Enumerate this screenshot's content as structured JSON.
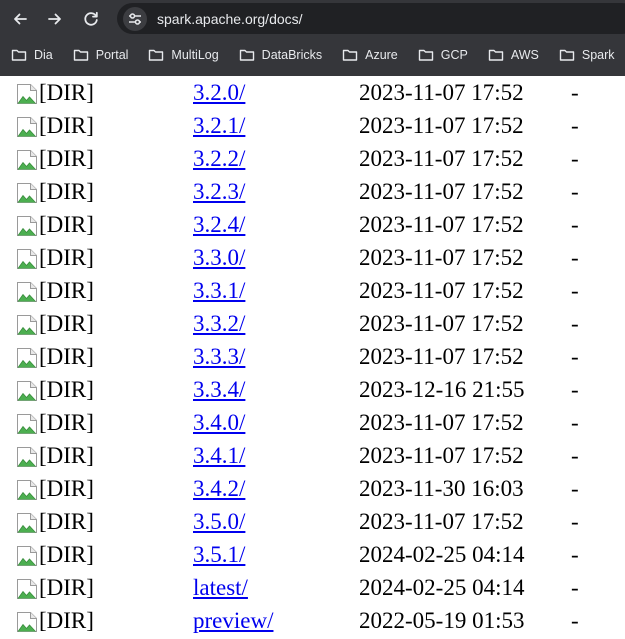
{
  "browser": {
    "url": "spark.apache.org/docs/",
    "bookmarks": [
      "Dia",
      "Portal",
      "MultiLog",
      "DataBricks",
      "Azure",
      "GCP",
      "AWS",
      "Spark"
    ]
  },
  "listing": {
    "rows": [
      {
        "alt": "[DIR]",
        "name": "3.2.0/",
        "modified": "2023-11-07 17:52",
        "size": "-"
      },
      {
        "alt": "[DIR]",
        "name": "3.2.1/",
        "modified": "2023-11-07 17:52",
        "size": "-"
      },
      {
        "alt": "[DIR]",
        "name": "3.2.2/",
        "modified": "2023-11-07 17:52",
        "size": "-"
      },
      {
        "alt": "[DIR]",
        "name": "3.2.3/",
        "modified": "2023-11-07 17:52",
        "size": "-"
      },
      {
        "alt": "[DIR]",
        "name": "3.2.4/",
        "modified": "2023-11-07 17:52",
        "size": "-"
      },
      {
        "alt": "[DIR]",
        "name": "3.3.0/",
        "modified": "2023-11-07 17:52",
        "size": "-"
      },
      {
        "alt": "[DIR]",
        "name": "3.3.1/",
        "modified": "2023-11-07 17:52",
        "size": "-"
      },
      {
        "alt": "[DIR]",
        "name": "3.3.2/",
        "modified": "2023-11-07 17:52",
        "size": "-"
      },
      {
        "alt": "[DIR]",
        "name": "3.3.3/",
        "modified": "2023-11-07 17:52",
        "size": "-"
      },
      {
        "alt": "[DIR]",
        "name": "3.3.4/",
        "modified": "2023-12-16 21:55",
        "size": "-"
      },
      {
        "alt": "[DIR]",
        "name": "3.4.0/",
        "modified": "2023-11-07 17:52",
        "size": "-"
      },
      {
        "alt": "[DIR]",
        "name": "3.4.1/",
        "modified": "2023-11-07 17:52",
        "size": "-"
      },
      {
        "alt": "[DIR]",
        "name": "3.4.2/",
        "modified": "2023-11-30 16:03",
        "size": "-"
      },
      {
        "alt": "[DIR]",
        "name": "3.5.0/",
        "modified": "2023-11-07 17:52",
        "size": "-"
      },
      {
        "alt": "[DIR]",
        "name": "3.5.1/",
        "modified": "2024-02-25 04:14",
        "size": "-"
      },
      {
        "alt": "[DIR]",
        "name": "latest/",
        "modified": "2024-02-25 04:14",
        "size": "-"
      },
      {
        "alt": "[DIR]",
        "name": "preview/",
        "modified": "2022-05-19 01:53",
        "size": "-"
      }
    ]
  },
  "icons": {
    "back": "arrow-left-icon",
    "forward": "arrow-right-icon",
    "reload": "reload-icon",
    "site_info": "tune-icon",
    "bookmark": "folder-icon",
    "row_image": "broken-image-icon"
  },
  "colors": {
    "chrome_bg": "#35363a",
    "omnibox_bg": "#202124",
    "chrome_text": "#e8eaed",
    "link": "#0000ee",
    "page_bg": "#ffffff"
  }
}
